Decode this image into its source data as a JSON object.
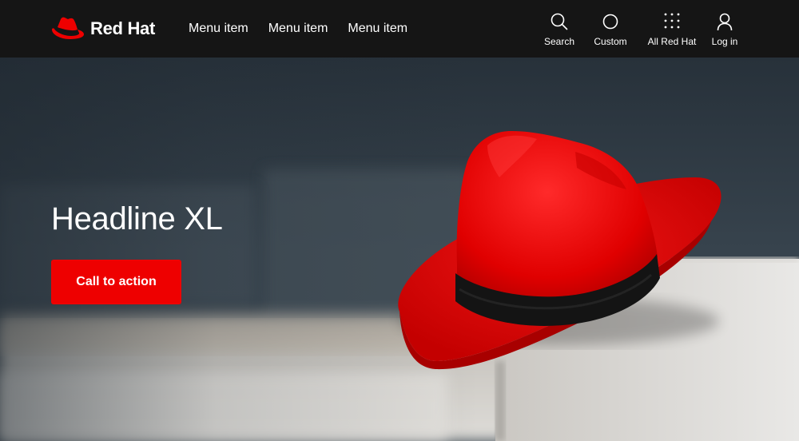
{
  "brand": {
    "name": "Red Hat",
    "logo_icon": "red-fedora-logo",
    "color": "#ee0000"
  },
  "nav": {
    "menu_items": [
      {
        "label": "Menu item"
      },
      {
        "label": "Menu item"
      },
      {
        "label": "Menu item"
      }
    ],
    "utilities": [
      {
        "label": "Search",
        "icon": "search-icon"
      },
      {
        "label": "Custom",
        "icon": "circle-icon"
      },
      {
        "label": "All Red Hat",
        "icon": "grid-icon"
      },
      {
        "label": "Log in",
        "icon": "user-icon"
      }
    ],
    "background": "#151515"
  },
  "hero": {
    "headline": "Headline XL",
    "cta_label": "Call to action",
    "cta_color": "#ee0000",
    "image": "red-fedora-hat-photo"
  }
}
